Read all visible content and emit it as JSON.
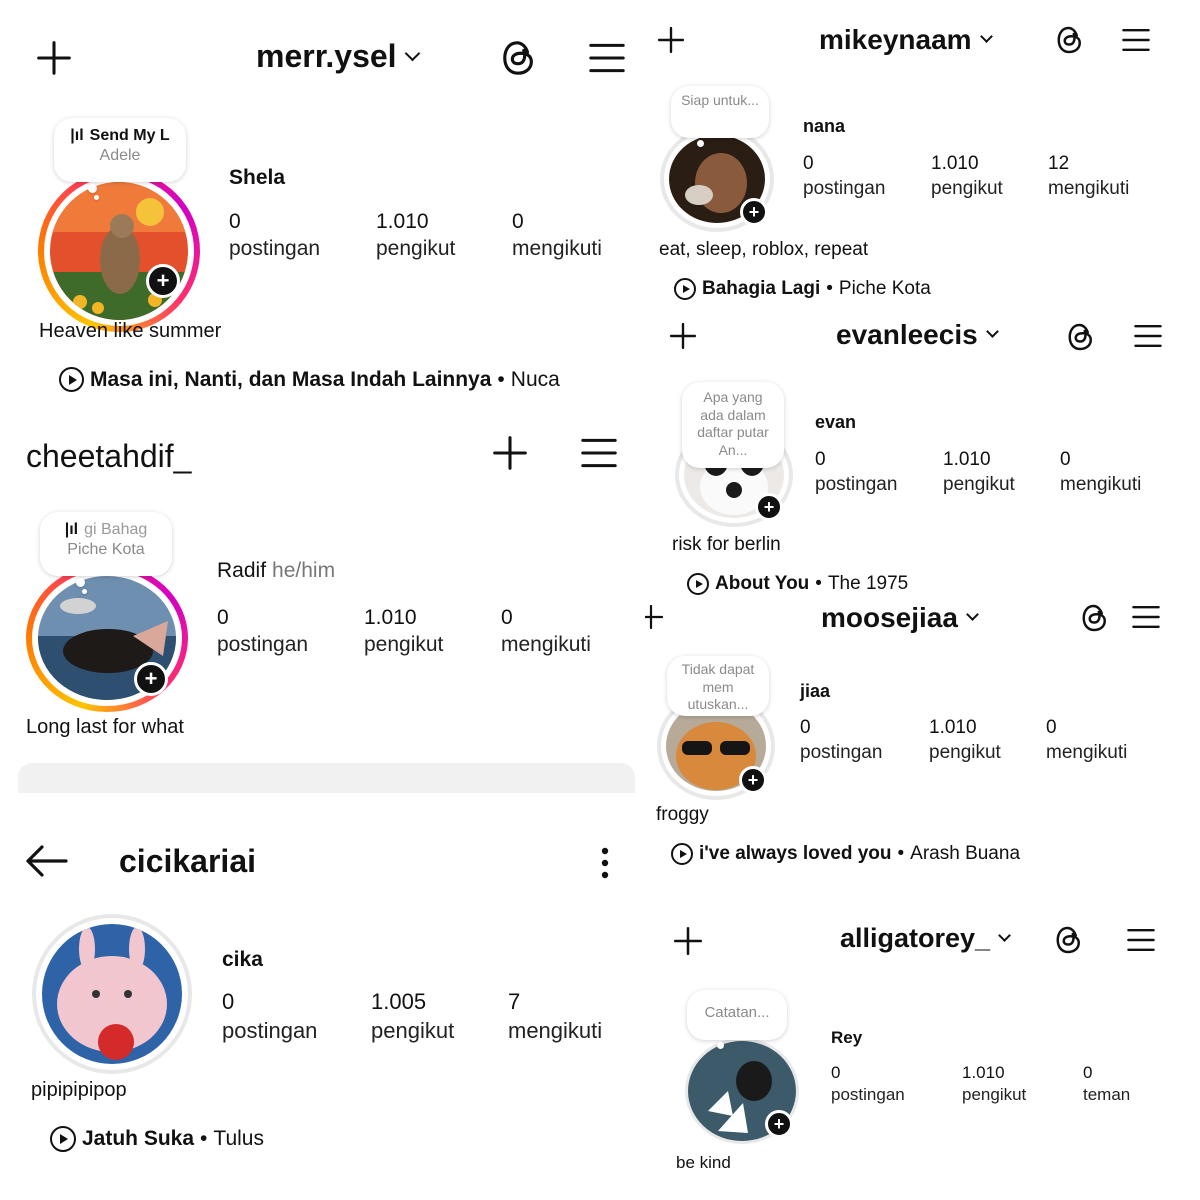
{
  "colors": {
    "accent_ring": "#ff2f6d",
    "text": "#111111",
    "muted": "#8a8a8a"
  },
  "icons": {
    "create": "plus-icon",
    "threads": "threads-icon",
    "menu": "hamburger-menu-icon",
    "back": "back-arrow-icon",
    "more": "more-vertical-icon",
    "play": "play-circle-icon",
    "add_story": "plus-badge-icon"
  },
  "profiles": {
    "merr": {
      "username": "merr.ysel",
      "note_song": "Send My L",
      "note_artist": "Adele",
      "name": "Shela",
      "posts": "0",
      "posts_label": "postingan",
      "followers": "1.010",
      "followers_label": "pengikut",
      "following": "0",
      "following_label": "mengikuti",
      "bio": "Heaven like summer",
      "music_title": "Masa ini, Nanti, dan Masa Indah Lainnya",
      "music_artist": "Nuca"
    },
    "cheetah": {
      "username": "cheetahdif_",
      "note_song": "gi    Bahag",
      "note_artist": "Piche Kota",
      "name": "Radif",
      "pronoun": "he/him",
      "posts": "0",
      "posts_label": "postingan",
      "followers": "1.010",
      "followers_label": "pengikut",
      "following": "0",
      "following_label": "mengikuti",
      "bio": "Long last for what"
    },
    "cici": {
      "username": "cicikariai",
      "name": "cika",
      "posts": "0",
      "posts_label": "postingan",
      "followers": "1.005",
      "followers_label": "pengikut",
      "following": "7",
      "following_label": "mengikuti",
      "bio": "pipipipipop",
      "music_title": "Jatuh Suka",
      "music_artist": "Tulus"
    },
    "mikey": {
      "username": "mikeynaam",
      "note": "Siap untuk...",
      "name": "nana",
      "posts": "0",
      "posts_label": "postingan",
      "followers": "1.010",
      "followers_label": "pengikut",
      "following": "12",
      "following_label": "mengikuti",
      "bio": "eat, sleep, roblox, repeat",
      "music_title": "Bahagia Lagi",
      "music_artist": "Piche Kota"
    },
    "evan": {
      "username": "evanleecis",
      "note": "Apa yang ada dalam daftar putar An...",
      "name": "evan",
      "posts": "0",
      "posts_label": "postingan",
      "followers": "1.010",
      "followers_label": "pengikut",
      "following": "0",
      "following_label": "mengikuti",
      "bio": "risk for berlin",
      "music_title": "About You",
      "music_artist": "The 1975"
    },
    "moose": {
      "username": "moosejiaa",
      "note": "Tidak dapat mem utuskan...",
      "name": "jiaa",
      "posts": "0",
      "posts_label": "postingan",
      "followers": "1.010",
      "followers_label": "pengikut",
      "following": "0",
      "following_label": "mengikuti",
      "bio": "froggy",
      "music_title": "i've always loved you",
      "music_artist": "Arash Buana"
    },
    "alli": {
      "username": "alligatorey_",
      "note": "Catatan...",
      "name": "Rey",
      "posts": "0",
      "posts_label": "postingan",
      "followers": "1.010",
      "followers_label": "pengikut",
      "following": "0",
      "following_label": "teman",
      "bio": "be kind"
    }
  },
  "separator": "•",
  "add_badge": "+"
}
